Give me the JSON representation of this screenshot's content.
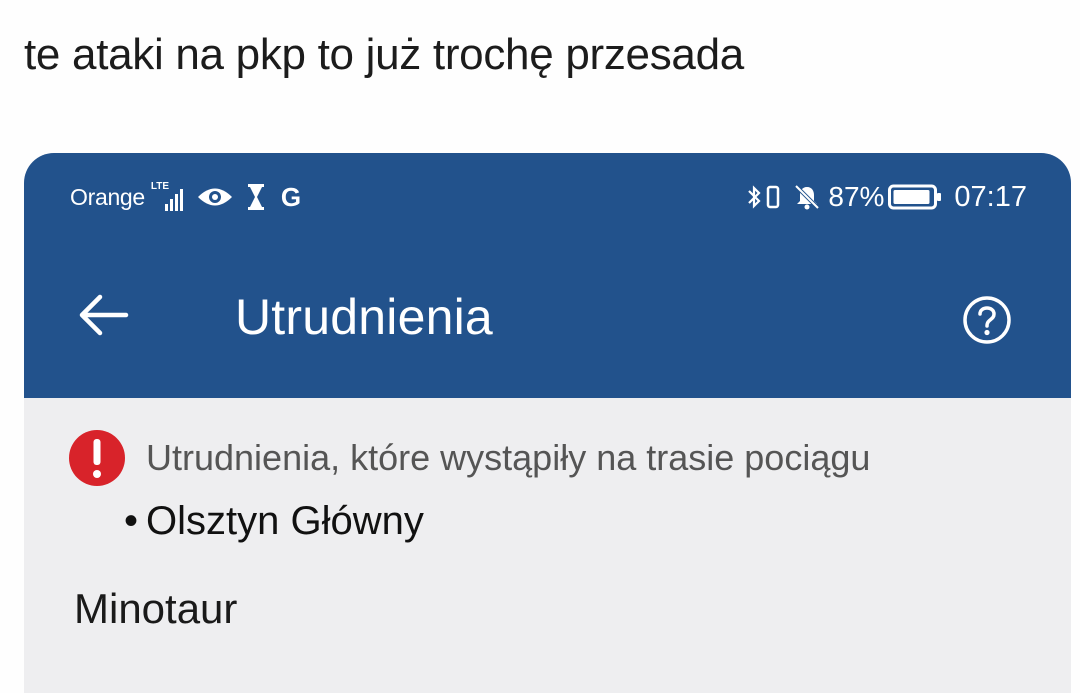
{
  "post": {
    "caption": "te ataki na pkp to już trochę przesada"
  },
  "status_bar": {
    "carrier": "Orange",
    "network": "LTE",
    "g_label": "G",
    "battery_percent": "87%",
    "time": "07:17"
  },
  "app_bar": {
    "title": "Utrudnienia"
  },
  "content": {
    "alert_text": "Utrudnienia, które wystąpiły na trasie pociągu",
    "bullet": "•",
    "station": "Olsztyn Główny",
    "extra_text": "Minotaur"
  },
  "colors": {
    "app_bar": "#22528c",
    "content_bg": "#eeeef0",
    "alert_red": "#d8232a"
  }
}
